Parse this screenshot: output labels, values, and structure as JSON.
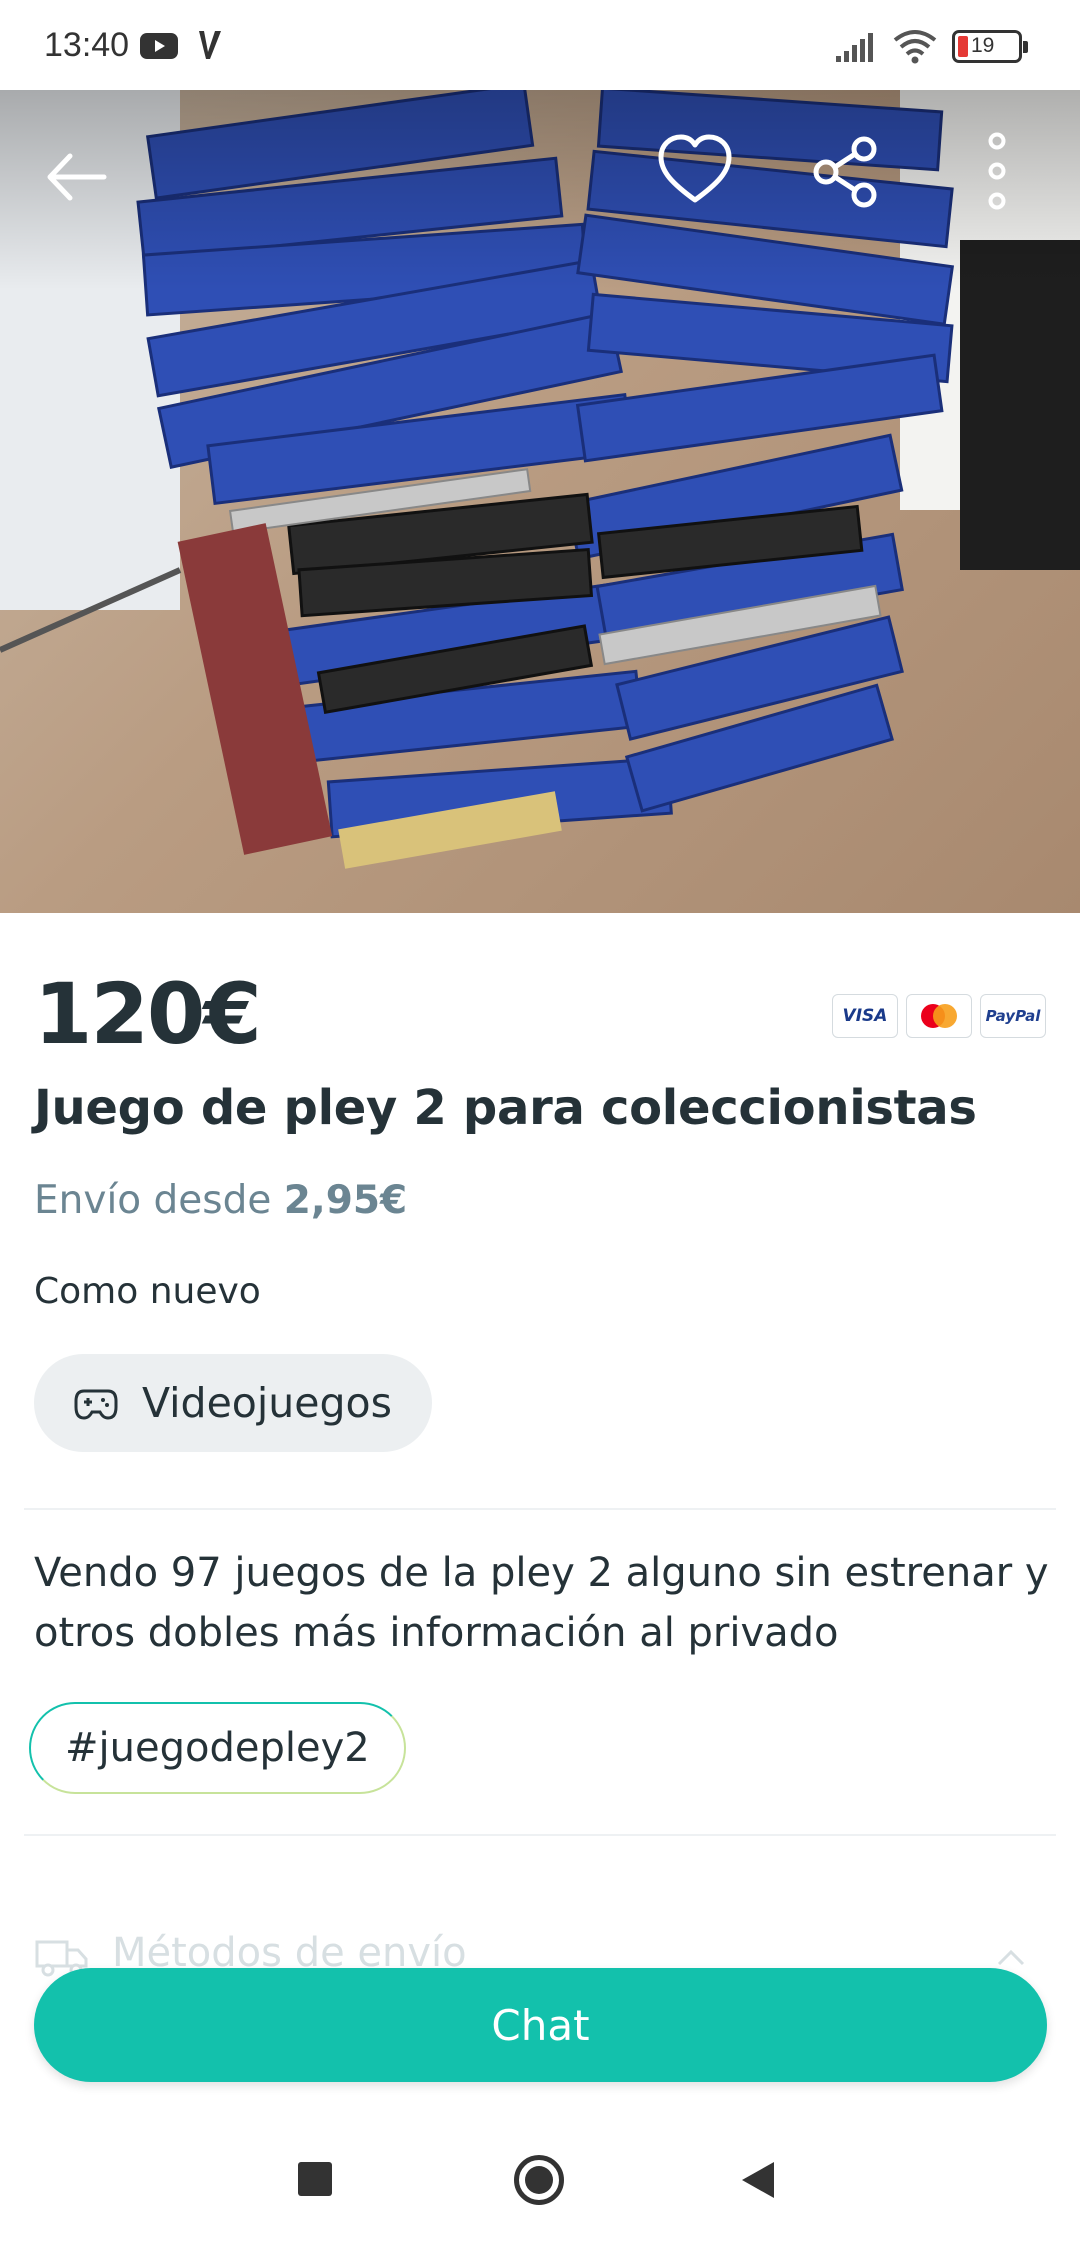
{
  "status_bar": {
    "time": "13:40",
    "battery": "19",
    "icons": [
      "youtube-icon",
      "v-app-icon",
      "signal-icon",
      "wifi-icon",
      "battery-icon"
    ]
  },
  "hero": {
    "image_description_icon": "product-photo",
    "buttons": [
      "back-arrow-icon",
      "heart-icon",
      "share-icon",
      "more-vertical-icon"
    ]
  },
  "listing": {
    "price": "120€",
    "payment_methods": [
      "VISA",
      "Mastercard",
      "PayPal"
    ],
    "title": "Juego de pley 2 para coleccionistas",
    "shipping_prefix": "Envío desde ",
    "shipping_price": "2,95€",
    "condition": "Como nuevo",
    "category": "Videojuegos",
    "description": "Vendo 97 juegos de la pley 2 alguno sin estrenar y otros dobles más información al privado",
    "hashtag": "#juegodepley2",
    "shipping_methods_label": "Métodos de envío"
  },
  "chat_button": {
    "label": "Chat"
  },
  "colors": {
    "accent": "#13c1ac",
    "text": "#253238",
    "muted": "#6b8592",
    "chip_bg": "#eceff1"
  }
}
